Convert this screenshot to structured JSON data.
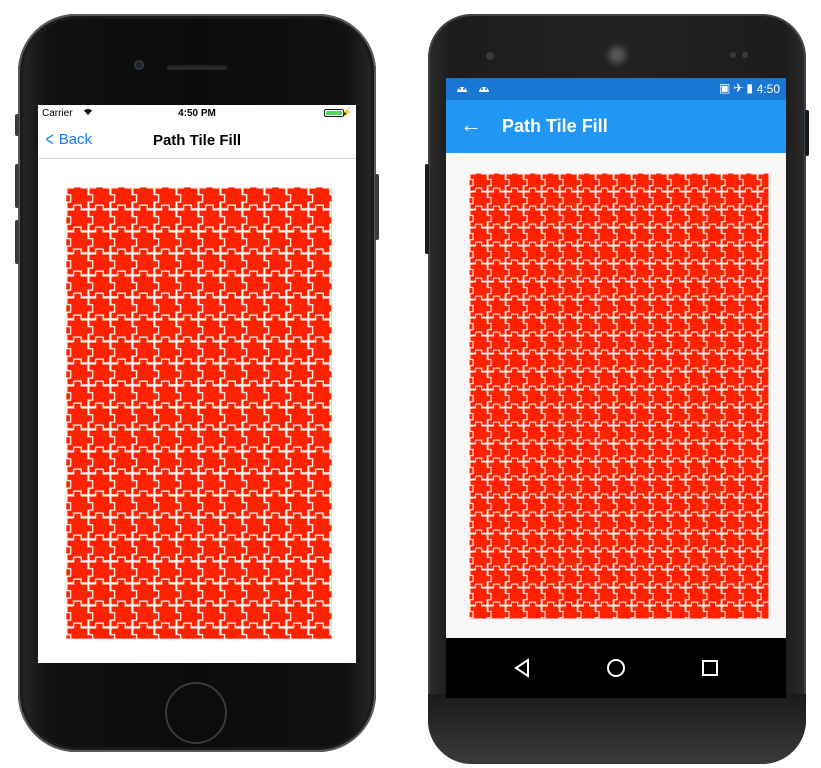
{
  "pattern_color": "#ff2200",
  "ios": {
    "status": {
      "carrier": "Carrier",
      "wifi_icon": "wifi-icon",
      "time": "4:50 PM",
      "battery_icon": "battery-icon"
    },
    "nav": {
      "back_label": "Back",
      "back_icon": "chevron-left-icon",
      "title": "Path Tile Fill"
    }
  },
  "android": {
    "status": {
      "left_icons": [
        "android-icon",
        "android-icon"
      ],
      "right_icons": [
        "no-sim-icon",
        "airplane-icon",
        "battery-icon"
      ],
      "time": "4:50"
    },
    "toolbar": {
      "back_icon": "arrow-left-icon",
      "title": "Path Tile Fill"
    },
    "navbar": {
      "buttons": [
        "back-triangle-icon",
        "home-circle-icon",
        "recents-square-icon"
      ]
    },
    "accent_color": "#2196f3",
    "status_color": "#1976d2"
  }
}
